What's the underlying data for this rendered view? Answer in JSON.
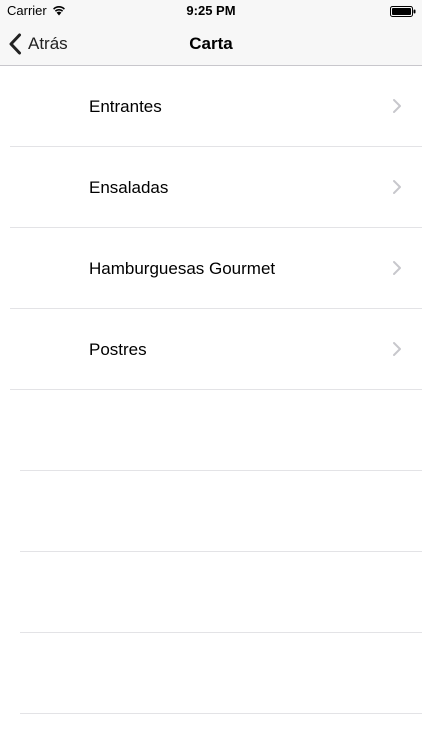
{
  "status_bar": {
    "carrier": "Carrier",
    "time": "9:25 PM",
    "wifi_icon": "wifi-icon",
    "battery_icon": "battery-icon"
  },
  "nav_bar": {
    "back_label": "Atrás",
    "back_icon": "chevron-left-icon",
    "title": "Carta"
  },
  "menu": {
    "items": [
      {
        "label": "Entrantes",
        "icon": "chevron-right-icon"
      },
      {
        "label": "Ensaladas",
        "icon": "chevron-right-icon"
      },
      {
        "label": "Hamburguesas Gourmet",
        "icon": "chevron-right-icon"
      },
      {
        "label": "Postres",
        "icon": "chevron-right-icon"
      }
    ],
    "empty_rows": 4
  },
  "colors": {
    "bar_background": "#f7f7f7",
    "separator": "#e3e3e6",
    "chevron": "#c7c7cc"
  }
}
